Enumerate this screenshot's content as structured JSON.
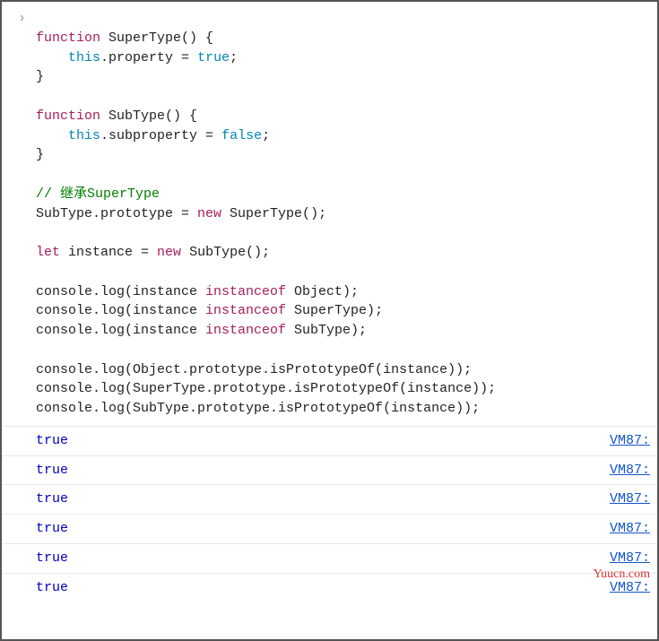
{
  "prompt": "›",
  "code": {
    "l01": {
      "a": "function",
      "b": " SuperType() {"
    },
    "l02": {
      "a": "this",
      "b": ".property = ",
      "c": "true",
      "d": ";"
    },
    "l03": "}",
    "l04": {
      "a": "function",
      "b": " SubType() {"
    },
    "l05": {
      "a": "this",
      "b": ".subproperty = ",
      "c": "false",
      "d": ";"
    },
    "l06": "}",
    "l07": "// 继承SuperType",
    "l08": {
      "a": "SubType.prototype = ",
      "b": "new",
      "c": " SuperType();"
    },
    "l09": {
      "a": "let",
      "b": " instance = ",
      "c": "new",
      "d": " SubType();"
    },
    "l10": {
      "a": "console.log(instance ",
      "b": "instanceof",
      "c": " Object);"
    },
    "l11": {
      "a": "console.log(instance ",
      "b": "instanceof",
      "c": " SuperType);"
    },
    "l12": {
      "a": "console.log(instance ",
      "b": "instanceof",
      "c": " SubType);"
    },
    "l13": "console.log(Object.prototype.isPrototypeOf(instance));",
    "l14": "console.log(SuperType.prototype.isPrototypeOf(instance));",
    "l15": "console.log(SubType.prototype.isPrototypeOf(instance));"
  },
  "outputs": [
    {
      "value": "true",
      "source": "VM87:"
    },
    {
      "value": "true",
      "source": "VM87:"
    },
    {
      "value": "true",
      "source": "VM87:"
    },
    {
      "value": "true",
      "source": "VM87:"
    },
    {
      "value": "true",
      "source": "VM87:"
    },
    {
      "value": "true",
      "source": "VM87:"
    }
  ],
  "watermark": "Yuucn.com"
}
